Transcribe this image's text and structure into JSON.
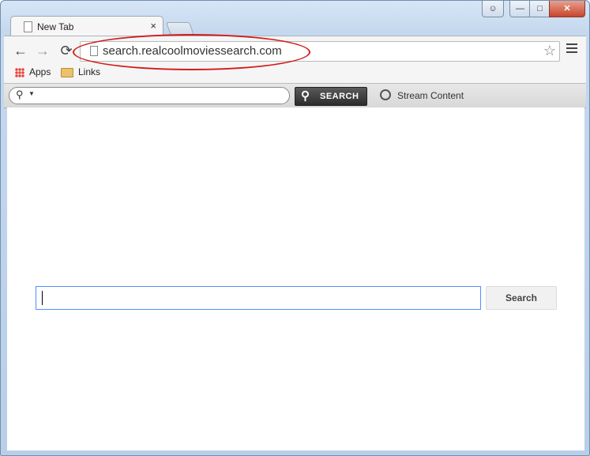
{
  "window": {
    "user_label": "☺",
    "minimize_label": "—",
    "maximize_label": "□",
    "close_label": "✕"
  },
  "tab": {
    "title": "New Tab",
    "close_label": "×"
  },
  "nav": {
    "back_label": "←",
    "forward_label": "→",
    "reload_label": "⟳"
  },
  "address_bar": {
    "url": "search.realcoolmoviessearch.com",
    "star_label": "☆"
  },
  "bookmarks": [
    {
      "label": "Apps",
      "icon": "apps-grid-icon"
    },
    {
      "label": "Links",
      "icon": "folder-icon"
    }
  ],
  "extension_bar": {
    "search_placeholder": "",
    "search_button_label": "SEARCH",
    "stream_label": "Stream Content"
  },
  "page": {
    "search_value": "",
    "search_button_label": "Search"
  },
  "colors": {
    "annotation": "#d21c1c",
    "focus_border": "#4d90fe",
    "close_button": "#c8452d"
  }
}
